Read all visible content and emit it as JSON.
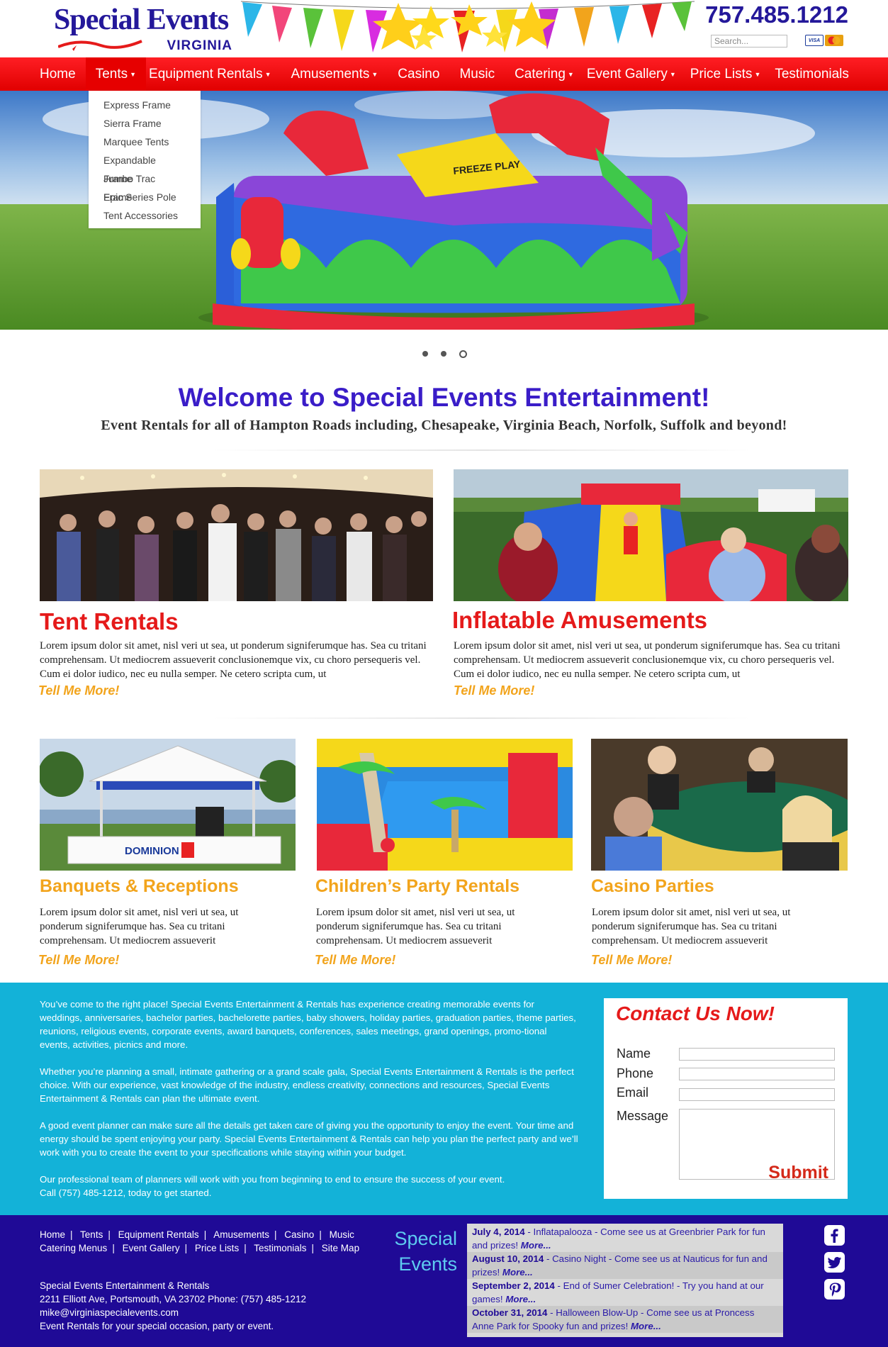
{
  "header": {
    "logo_main": "Special Events",
    "logo_sub": "VIRGINIA",
    "phone": "757.485.1212",
    "search_placeholder": "Search...",
    "card_visa": "VISA",
    "card_mc": "MasterCard"
  },
  "nav": {
    "items": [
      {
        "label": "Home"
      },
      {
        "label": "Tents"
      },
      {
        "label": "Equipment Rentals"
      },
      {
        "label": "Amusements"
      },
      {
        "label": "Casino"
      },
      {
        "label": "Music"
      },
      {
        "label": "Catering"
      },
      {
        "label": "Event Gallery"
      },
      {
        "label": "Price Lists"
      },
      {
        "label": "Testimonials"
      }
    ],
    "dropdown": [
      "Express Frame",
      "Sierra Frame",
      "Marquee Tents",
      "Expandable Frame",
      "Jumbo Trac Frame",
      "Epic Series Pole",
      "Tent Accessories"
    ]
  },
  "slider": {
    "active_slide": 3,
    "slide_count": 3
  },
  "welcome": {
    "title": "Welcome to Special Events Entertainment!",
    "subtitle": "Event Rentals for all of Hampton Roads including, Chesapeake, Virginia Beach, Norfolk, Suffolk and beyond!"
  },
  "features": {
    "tent": {
      "title": "Tent Rentals",
      "text": "Lorem ipsum dolor sit amet, nisl veri ut sea, ut ponderum signiferumque has. Sea cu tritani comprehensam. Ut mediocrem assueverit conclusionemque vix, cu choro persequeris vel. Cum ei dolor iudico, nec eu nulla semper. Ne cetero scripta cum, ut",
      "more": "Tell Me More!"
    },
    "inflatable": {
      "title": "Inflatable Amusements",
      "text": "Lorem ipsum dolor sit amet, nisl veri ut sea, ut ponderum signiferumque has. Sea cu tritani comprehensam. Ut mediocrem assueverit conclusionemque vix, cu choro persequeris vel. Cum ei dolor iudico, nec eu nulla semper. Ne cetero scripta cum, ut",
      "more": "Tell Me More!"
    },
    "banquets": {
      "title": "Banquets & Receptions",
      "text": "Lorem ipsum dolor sit amet, nisl veri ut sea, ut ponderum signiferumque has. Sea cu tritani comprehensam. Ut mediocrem assueverit",
      "more": "Tell Me More!"
    },
    "children": {
      "title": "Children’s Party Rentals",
      "text": "Lorem ipsum dolor sit amet, nisl veri ut sea, ut ponderum signiferumque has. Sea cu tritani comprehensam. Ut mediocrem assueverit",
      "more": "Tell Me More!"
    },
    "casino": {
      "title": "Casino Parties",
      "text": "Lorem ipsum dolor sit amet, nisl veri ut sea, ut ponderum signiferumque has. Sea cu tritani comprehensam. Ut mediocrem assueverit",
      "more": "Tell Me More!"
    },
    "image_labels": {
      "dominion_banner": "DOMINION",
      "inflatable_sign": "FREEZE PLAY"
    }
  },
  "about": {
    "p1": "You’ve come to the right place! Special Events Entertainment & Rentals has experience creating memorable events for weddings, anniversaries, bachelor parties, bachelorette parties, baby showers, holiday parties, graduation parties, theme parties, reunions, religious events, corporate events, award banquets, conferences, sales meetings, grand openings, promo-tional events,  activities, picnics and more.",
    "p2": "Whether you’re planning a small, intimate gathering or a grand scale gala, Special Events Entertainment & Rentals is the perfect choice. With our experience, vast knowledge of the industry, endless creativity, connections and resources, Special Events Entertainment & Rentals can plan the ultimate event.",
    "p3": "A good event planner can make sure all the details get taken care of giving you the opportunity to enjoy the event. Your time and energy should be spent enjoying your party. Special Events Entertainment & Rentals can help you plan the perfect party and we’ll work with you to create the event to your specifications while staying within your budget.",
    "p4a": "Our professional team of planners will work with you from beginning to end to ensure the success of your event.",
    "p4b": "Call (757) 485-1212, today to get started."
  },
  "contact": {
    "title": "Contact Us Now!",
    "name_label": "Name",
    "phone_label": "Phone",
    "email_label": "Email",
    "message_label": "Message",
    "name_value": "",
    "phone_value": "",
    "email_value": "",
    "message_value": "",
    "submit": "Submit"
  },
  "footer": {
    "links_row1": [
      "Home",
      "Tents",
      "Equipment Rentals",
      "Amusements",
      "Casino",
      "Music"
    ],
    "links_row2": [
      "Catering Menus",
      "Event Gallery",
      "Price Lists",
      "Testimonials",
      "Site Map"
    ],
    "company": "Special Events Entertainment & Rentals",
    "address": "2211 Elliott Ave, Portsmouth, VA 23702   Phone: (757) 485-1212",
    "email": "mike@virginiaspecialevents.com",
    "tagline": "Event Rentals for your special occasion, party or event.",
    "brand_line1": "Special",
    "brand_line2": "Events",
    "events": [
      {
        "date": "July 4, 2014",
        "text": "Inflatapalooza - Come see us at Greenbrier Park for fun and prizes!",
        "more": "More..."
      },
      {
        "date": "August 10, 2014",
        "text": "Casino Night - Come see us at Nauticus for fun and prizes!",
        "more": "More..."
      },
      {
        "date": "September 2, 2014",
        "text": "End of Sumer Celebration! - Try you hand at our games!",
        "more": "More..."
      },
      {
        "date": "October 31, 2014",
        "text": "Halloween Blow-Up - Come see us at Proncess Anne Park for  Spooky fun and prizes!",
        "more": "More..."
      }
    ],
    "social": [
      "facebook-icon",
      "twitter-icon",
      "pinterest-icon"
    ]
  },
  "colors": {
    "nav_red": "#ff1e24",
    "welcome_purple": "#3a1dc8",
    "title_red": "#e51a1a",
    "accent_orange": "#f2a41c",
    "section_blue": "#13b2d8",
    "footer_navy": "#1f0a96"
  }
}
